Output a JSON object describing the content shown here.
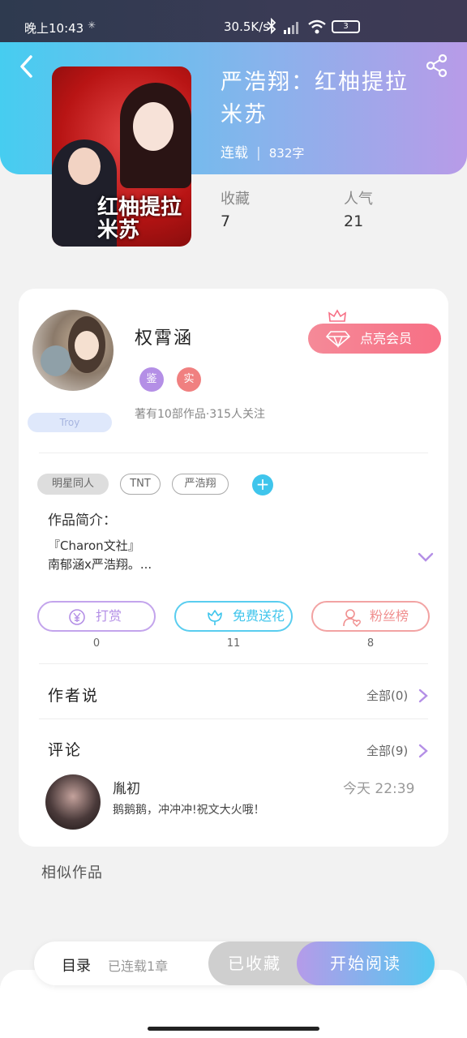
{
  "status_bar": {
    "time": "晚上10:43",
    "network_speed": "30.5K/s",
    "battery": "3"
  },
  "book": {
    "title": "严浩翔：红柚提拉米苏",
    "status": "连载",
    "word_count": "832字",
    "favorites_label": "收藏",
    "favorites_value": "7",
    "popularity_label": "人气",
    "popularity_value": "21",
    "cover_title": "红柚提拉米苏"
  },
  "author": {
    "name": "权霄涵",
    "avatar_tag": "Troy",
    "badge_1": "鉴",
    "badge_2": "实",
    "meta": "著有10部作品·315人关注",
    "vip_button": "点亮会员"
  },
  "tags": [
    "明星同人",
    "TNT",
    "严浩翔"
  ],
  "intro": {
    "title": "作品简介：",
    "line1": "『Charon文社』",
    "line2": "南郁涵x严浩翔。..."
  },
  "actions": {
    "tip_label": "打赏",
    "tip_count": "0",
    "flower_label": "免费送花",
    "flower_count": "11",
    "fans_label": "粉丝榜",
    "fans_count": "8"
  },
  "author_says": {
    "title": "作者说",
    "all_label": "全部(0)"
  },
  "comments": {
    "title": "评论",
    "all_label": "全部(9)",
    "items": [
      {
        "user": "胤初",
        "time": "今天 22:39",
        "text": "鹅鹅鹅，冲冲冲!祝文大火哦！"
      }
    ]
  },
  "similar": {
    "title": "相似作品"
  },
  "bottom_bar": {
    "toc_label": "目录",
    "toc_status": "已连载1章",
    "fav_button": "已收藏",
    "read_button": "开始阅读"
  },
  "colors": {
    "header_gradient_start": "#46cdf0",
    "header_gradient_end": "#b89be8",
    "vip": "#f76f85",
    "tip": "#b48fe6",
    "flower": "#3fc5ec",
    "fans": "#f08f8f"
  }
}
